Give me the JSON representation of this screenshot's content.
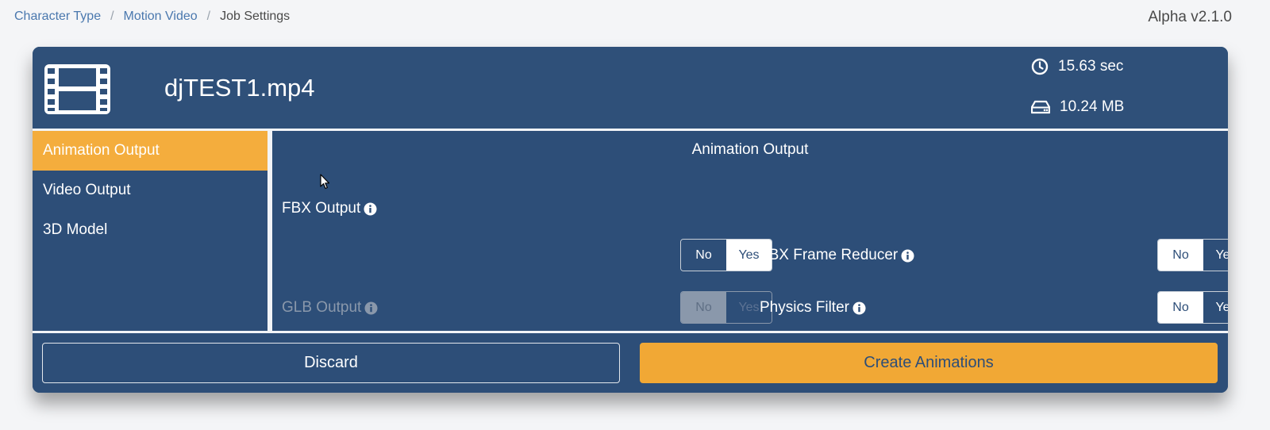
{
  "breadcrumb": {
    "items": [
      {
        "label": "Character Type"
      },
      {
        "label": "Motion Video"
      },
      {
        "label": "Job Settings"
      }
    ],
    "separator": "/"
  },
  "version": "Alpha v2.1.0",
  "file": {
    "name": "djTEST1.mp4",
    "icon": "film-icon",
    "duration": "15.63 sec",
    "size": "10.24 MB"
  },
  "sidebar": {
    "items": [
      {
        "label": "Animation Output",
        "active": true
      },
      {
        "label": "Video Output",
        "active": false
      },
      {
        "label": "3D Model",
        "active": false
      }
    ]
  },
  "content": {
    "title": "Animation Output",
    "options": [
      {
        "label": "FBX Output",
        "no": "No",
        "yes": "Yes",
        "selected": "No",
        "enabled": true
      },
      {
        "label": "GLB Output",
        "no": "No",
        "yes": "Yes",
        "selected": "No",
        "enabled": false
      },
      {
        "label": "FBX Frame Reducer",
        "no": "No",
        "yes": "Yes",
        "selected": "Yes",
        "enabled": true
      },
      {
        "label": "Physics Filter",
        "no": "No",
        "yes": "Yes",
        "selected": "Yes",
        "enabled": true
      }
    ]
  },
  "footer": {
    "discard_label": "Discard",
    "create_label": "Create Animations"
  },
  "colors": {
    "panel": "#2d4e78",
    "accent": "#f1a835",
    "link": "#4a78ae",
    "disabled": "#8a98ab"
  }
}
